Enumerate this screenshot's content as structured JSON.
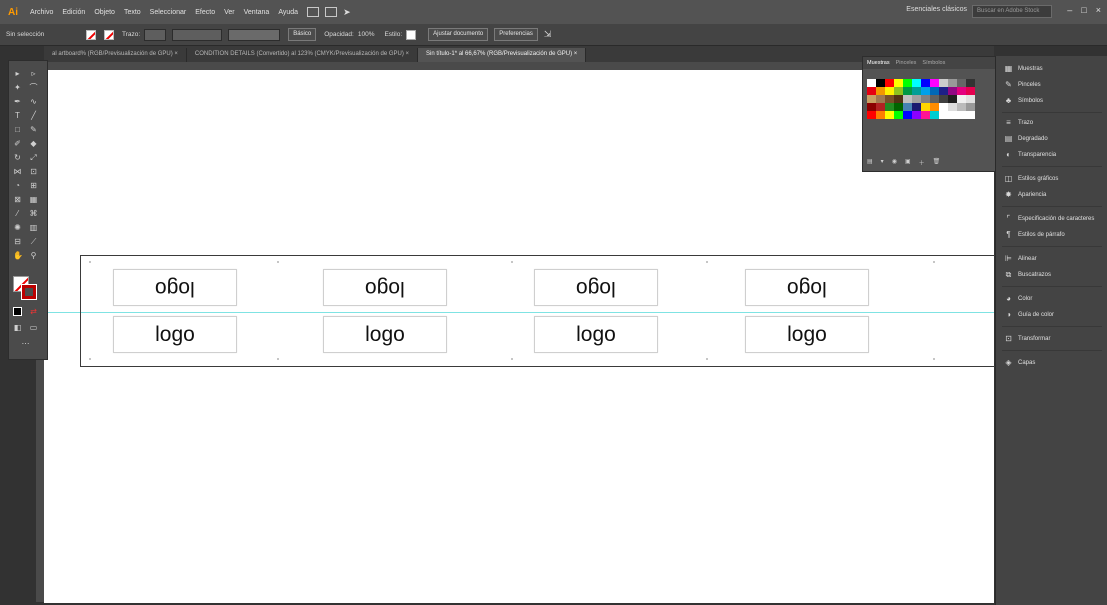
{
  "app": {
    "logo": "Ai"
  },
  "menu": [
    "Archivo",
    "Edición",
    "Objeto",
    "Texto",
    "Seleccionar",
    "Efecto",
    "Ver",
    "Ventana",
    "Ayuda"
  ],
  "workspace_label": "Esenciales clásicos",
  "search_placeholder": "Buscar en Adobe Stock",
  "window_controls": [
    "–",
    "□",
    "×"
  ],
  "controlbar": {
    "selection_label": "Sin selección",
    "stroke_label": "Trazo:",
    "brush_label": "Básico",
    "opacity_label": "Opacidad:",
    "opacity_value": "100%",
    "style_label": "Estilo:",
    "doc_setup_button": "Ajustar documento",
    "prefs_button": "Preferencias"
  },
  "tabs": [
    {
      "label": "al artboard% (RGB/Previsualización de GPU)",
      "active": false
    },
    {
      "label": "CONDITION DETAILS (Convertido) al 123% (CMYK/Previsualización de GPU)",
      "active": false
    },
    {
      "label": "Sin título-1* al 66,67% (RGB/Previsualización de GPU)",
      "active": true
    }
  ],
  "artboard": {
    "top_row_text": "logo",
    "bottom_row_text": "logo",
    "columns": 4
  },
  "swatches_panel": {
    "tabs": [
      "Muestras",
      "Pinceles",
      "Símbolos"
    ],
    "colors": [
      [
        "#ffffff",
        "#000000",
        "#ff0000",
        "#ffff00",
        "#00ff00",
        "#00ffff",
        "#0000ff",
        "#ff00ff",
        "#cccccc",
        "#999999",
        "#666666",
        "#333333"
      ],
      [
        "#e60012",
        "#f39800",
        "#fff100",
        "#8fc31f",
        "#009944",
        "#009e96",
        "#00a0e9",
        "#0068b7",
        "#1d2088",
        "#920783",
        "#e4007f",
        "#e5004f"
      ],
      [
        "#c8a064",
        "#a07850",
        "#785028",
        "#503214",
        "#c0c0c0",
        "#a0a0a0",
        "#808080",
        "#606060",
        "#404040",
        "#202020",
        "#f0f0f0",
        "#e0e0e0"
      ],
      [
        "#8b0000",
        "#b22222",
        "#228b22",
        "#006400",
        "#4682b4",
        "#191970",
        "#ffd700",
        "#ff8c00",
        "#ffffff",
        "#dddddd",
        "#bbbbbb",
        "#999999"
      ],
      [
        "#ff0000",
        "#ff7f00",
        "#ffff00",
        "#00ff00",
        "#0000ff",
        "#8b00ff",
        "#ff1493",
        "#00ced1",
        "#ffffff",
        "#ffffff",
        "#ffffff",
        "#ffffff"
      ]
    ]
  },
  "dock": [
    "Muestras",
    "Pinceles",
    "Símbolos",
    "Trazo",
    "Degradado",
    "Transparencia",
    "Estilos gráficos",
    "Apariencia",
    "Especificación de caracteres",
    "Estilos de párrafo",
    "Alinear",
    "Buscatrazos",
    "Color",
    "Guía de color",
    "Transformar",
    "Capas"
  ]
}
